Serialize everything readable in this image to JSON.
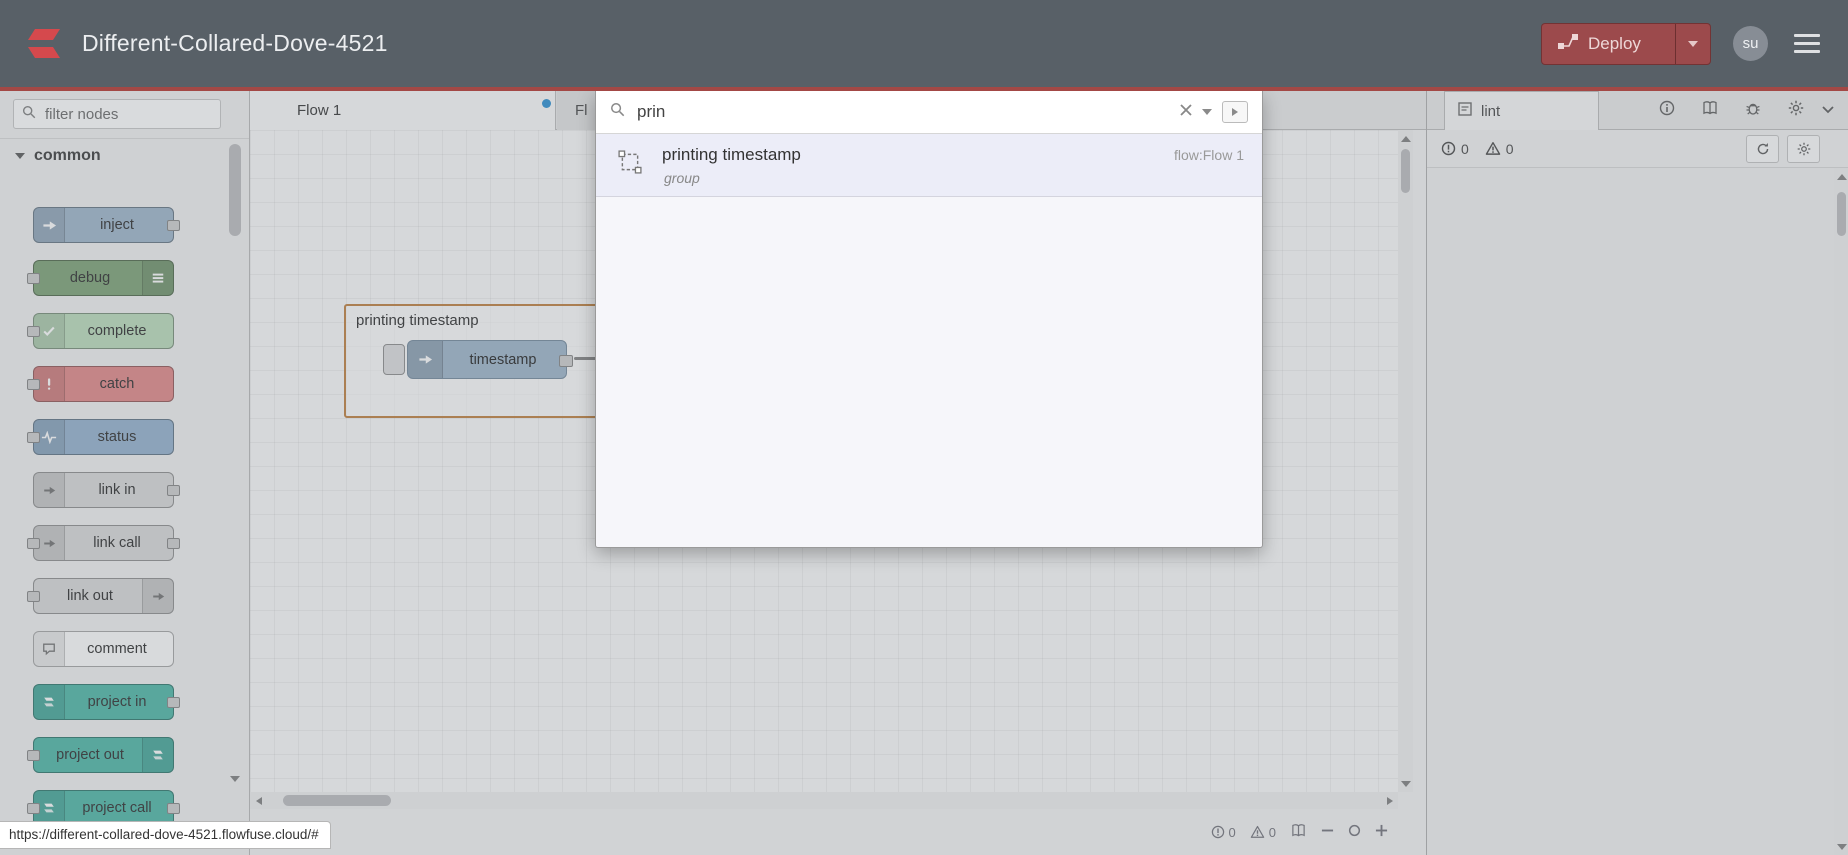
{
  "header": {
    "title": "Different-Collared-Dove-4521",
    "deploy_label": "Deploy",
    "avatar_initials": "su"
  },
  "colors": {
    "header": "#586067",
    "accent": "#a34845",
    "deploy": "#9c4a4c",
    "tab_dot": "#3b98d6",
    "group_border": "#c4894e"
  },
  "palette": {
    "filter_placeholder": "filter nodes",
    "category_label": "common",
    "nodes": [
      {
        "label": "inject",
        "color": "#a6bbcf",
        "icon": "inject-icon",
        "icon_side": "left",
        "ports": "right"
      },
      {
        "label": "debug",
        "color": "#87a980",
        "icon": "debug-icon",
        "icon_side": "right",
        "ports": "left"
      },
      {
        "label": "complete",
        "color": "#c0dfc0",
        "icon": "complete-icon",
        "icon_side": "left",
        "ports": "left"
      },
      {
        "label": "catch",
        "color": "#e49191",
        "icon": "catch-icon",
        "icon_side": "left",
        "ports": "left"
      },
      {
        "label": "status",
        "color": "#9db8d2",
        "icon": "status-icon",
        "icon_side": "left",
        "ports": "left"
      },
      {
        "label": "link in",
        "color": "#dddddd",
        "icon": "link-icon",
        "icon_side": "left",
        "ports": "right"
      },
      {
        "label": "link call",
        "color": "#dddddd",
        "icon": "link-icon",
        "icon_side": "left",
        "ports": "both"
      },
      {
        "label": "link out",
        "color": "#dddddd",
        "icon": "link-icon",
        "icon_side": "right",
        "ports": "left"
      },
      {
        "label": "comment",
        "color": "#fefefe",
        "icon": "comment-icon",
        "icon_side": "left",
        "ports": "none"
      },
      {
        "label": "project in",
        "color": "#5bbdae",
        "icon": "project-icon",
        "icon_side": "left",
        "ports": "right"
      },
      {
        "label": "project out",
        "color": "#5bbdae",
        "icon": "project-icon",
        "icon_side": "right",
        "ports": "left"
      },
      {
        "label": "project call",
        "color": "#5bbdae",
        "icon": "project-icon",
        "icon_side": "left",
        "ports": "both"
      }
    ]
  },
  "workspace": {
    "active_tab": "Flow 1",
    "partial_tab": "Fl",
    "group_label": "printing timestamp",
    "node_label": "timestamp"
  },
  "search": {
    "query": "prin",
    "results": [
      {
        "title": "printing timestamp",
        "subtitle": "group",
        "flow_ref": "flow:Flow 1"
      }
    ]
  },
  "sidebar": {
    "active_tab_label": "lint",
    "error_count": "0",
    "warning_count": "0"
  },
  "status_bar": {
    "url": "https://different-collared-dove-4521.flowfuse.cloud/#",
    "info_count": "0",
    "warning_count": "0"
  }
}
